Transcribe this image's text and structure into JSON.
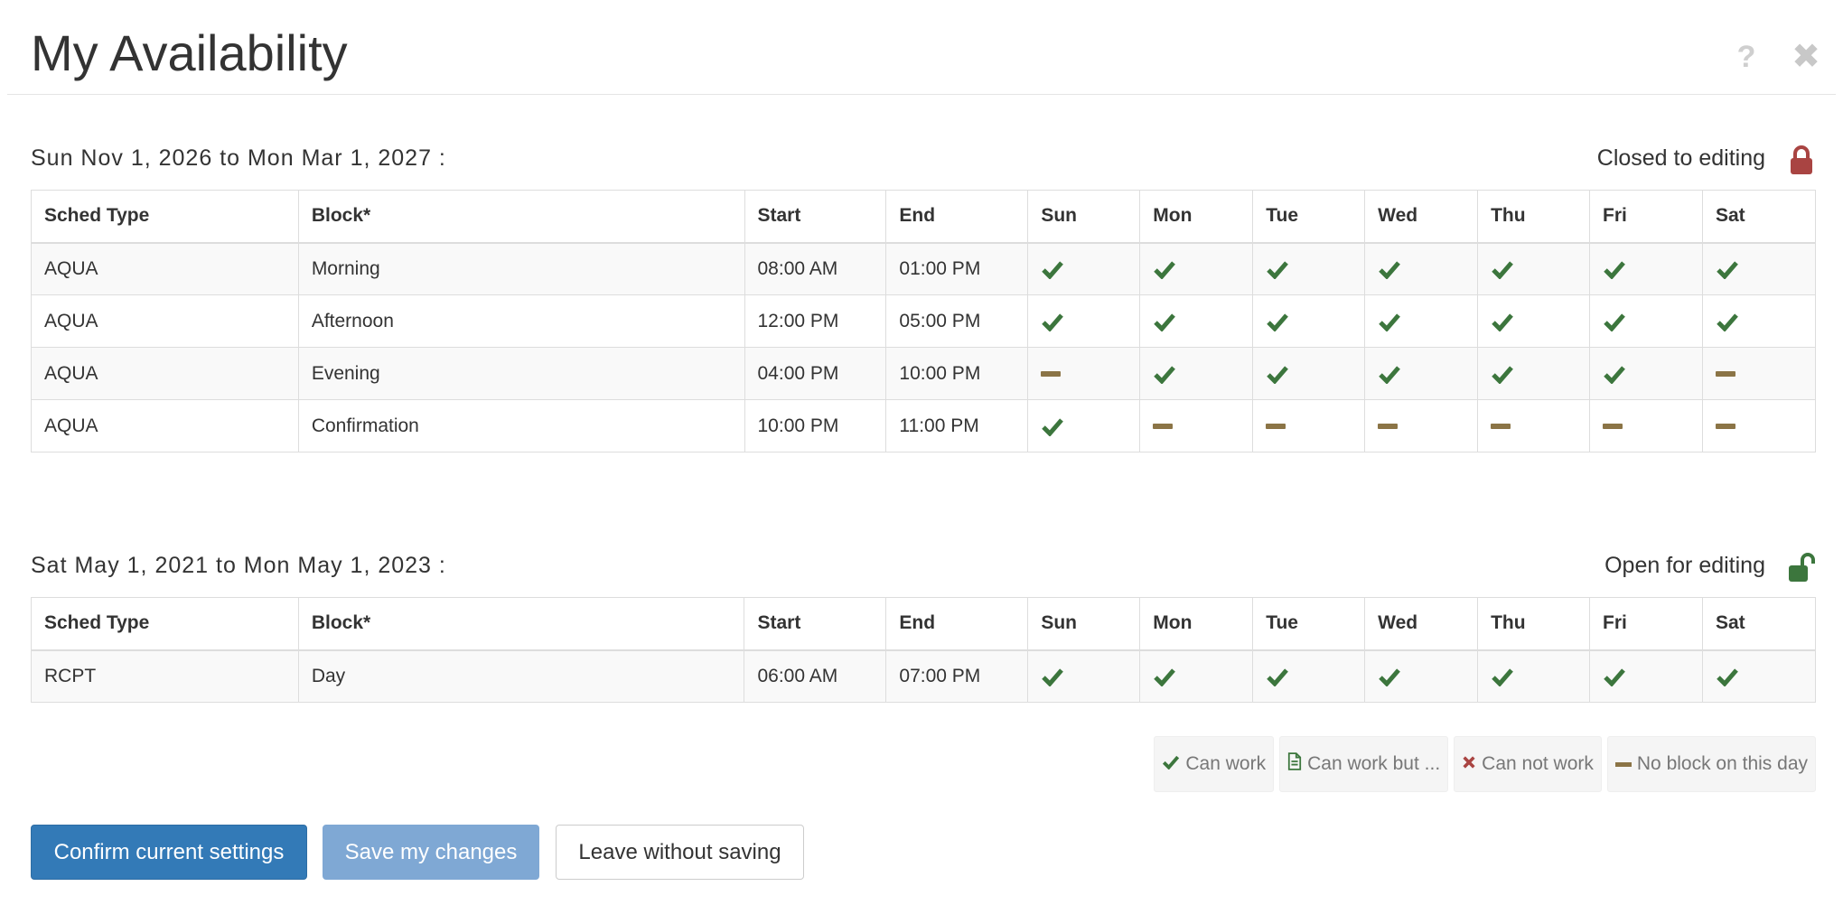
{
  "header": {
    "title": "My Availability",
    "help_glyph": "?",
    "close_glyph": "✖"
  },
  "columns": [
    "Sched Type",
    "Block*",
    "Start",
    "End",
    "Sun",
    "Mon",
    "Tue",
    "Wed",
    "Thu",
    "Fri",
    "Sat"
  ],
  "periods": [
    {
      "title": "Sun Nov 1, 2026 to Mon Mar 1, 2027 :",
      "status": "Closed to editing",
      "lock_icon": "lock-closed-icon",
      "rows": [
        {
          "type": "AQUA",
          "block": "Morning",
          "start": "08:00 AM",
          "end": "01:00 PM",
          "days": [
            "check",
            "check",
            "check",
            "check",
            "check",
            "check",
            "check"
          ]
        },
        {
          "type": "AQUA",
          "block": "Afternoon",
          "start": "12:00 PM",
          "end": "05:00 PM",
          "days": [
            "check",
            "check",
            "check",
            "check",
            "check",
            "check",
            "check"
          ]
        },
        {
          "type": "AQUA",
          "block": "Evening",
          "start": "04:00 PM",
          "end": "10:00 PM",
          "days": [
            "dash",
            "check",
            "check",
            "check",
            "check",
            "check",
            "dash"
          ]
        },
        {
          "type": "AQUA",
          "block": "Confirmation",
          "start": "10:00 PM",
          "end": "11:00 PM",
          "days": [
            "check",
            "dash",
            "dash",
            "dash",
            "dash",
            "dash",
            "dash"
          ]
        }
      ]
    },
    {
      "title": "Sat May 1, 2021 to Mon May 1, 2023 :",
      "status": "Open for editing",
      "lock_icon": "lock-open-icon",
      "rows": [
        {
          "type": "RCPT",
          "block": "Day",
          "start": "06:00 AM",
          "end": "07:00 PM",
          "days": [
            "check",
            "check",
            "check",
            "check",
            "check",
            "check",
            "check"
          ]
        }
      ]
    }
  ],
  "legend": [
    {
      "icon": "check-icon",
      "label": "Can work"
    },
    {
      "icon": "document-icon",
      "label": "Can work but ..."
    },
    {
      "icon": "x-icon",
      "label": "Can not work"
    },
    {
      "icon": "dash-icon",
      "label": "No block on this day"
    }
  ],
  "buttons": {
    "confirm": "Confirm current settings",
    "save": "Save my changes",
    "leave": "Leave without saving"
  },
  "colors": {
    "check": "#3c763d",
    "dash": "#8b7446",
    "x": "#a94442",
    "lock_closed": "#a94442",
    "lock_open": "#3c763d",
    "primary": "#337ab7",
    "primary_disabled": "#7fa8d4"
  }
}
